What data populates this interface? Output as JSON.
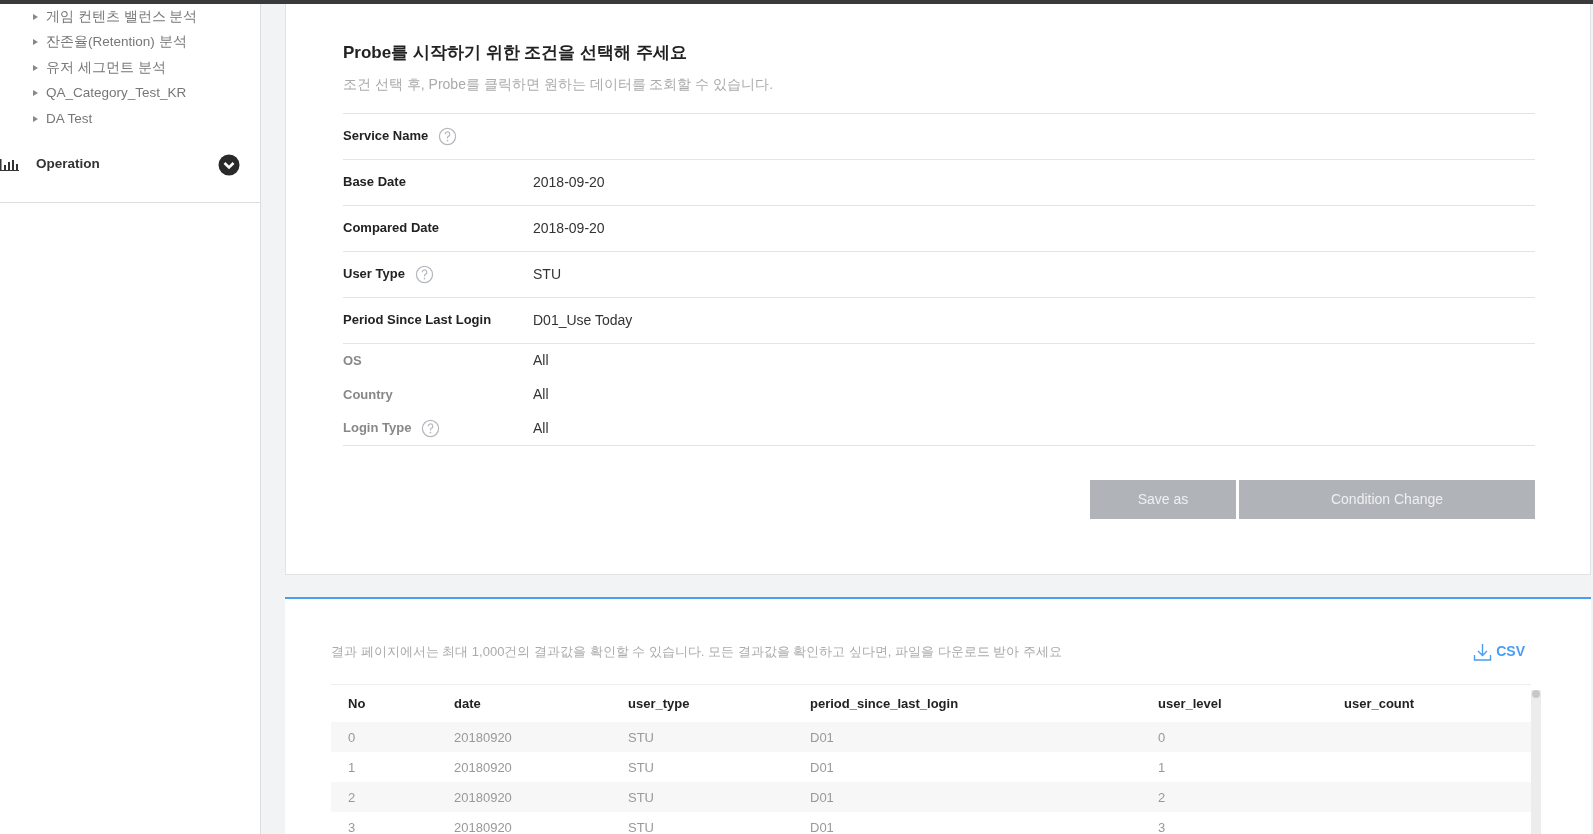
{
  "sidebar": {
    "items": [
      {
        "label": "게임 컨텐츠 밸런스 분석"
      },
      {
        "label": "잔존율(Retention) 분석"
      },
      {
        "label": "유저 세그먼트 분석"
      },
      {
        "label": "QA_Category_Test_KR"
      },
      {
        "label": "DA Test"
      }
    ],
    "section": {
      "label": "Operation",
      "expanded": true
    }
  },
  "conditions": {
    "title": "Probe를 시작하기 위한 조건을 선택해 주세요",
    "subtitle": "조건 선택 후, Probe를 클릭하면 원하는 데이터를 조회할 수 있습니다.",
    "rows": [
      {
        "kind": "main",
        "label": "Service Name",
        "help": true
      },
      {
        "kind": "main",
        "label": "Base Date",
        "help": false,
        "value": "2018-09-20"
      },
      {
        "kind": "main",
        "label": "Compared Date",
        "help": false,
        "value": "2018-09-20"
      },
      {
        "kind": "main",
        "label": "User Type",
        "help": true,
        "value": "STU"
      },
      {
        "kind": "main",
        "label": "Period Since Last Login",
        "help": false,
        "value": "D01_Use Today"
      },
      {
        "kind": "minor",
        "label": "OS",
        "help": false,
        "value": "All"
      },
      {
        "kind": "minor",
        "label": "Country",
        "help": false,
        "value": "All"
      },
      {
        "kind": "minor",
        "label": "Login Type",
        "help": true,
        "value": "All"
      }
    ],
    "buttons": [
      {
        "label": "Save as",
        "disabled": true
      },
      {
        "label": "Condition Change",
        "disabled": true
      }
    ]
  },
  "results": {
    "notice": "결과 페이지에서는 최대 1,000건의 결과값을 확인할 수 있습니다. 모든 결과값을 확인하고 싶다면, 파일을 다운로드 받아 주세요",
    "download": "CSV",
    "columns": [
      "No",
      "date",
      "user_type",
      "period_since_last_login",
      "user_level",
      "user_count"
    ],
    "rows": [
      [
        "0",
        "20180920",
        "STU",
        "D01",
        "0",
        ""
      ],
      [
        "1",
        "20180920",
        "STU",
        "D01",
        "1",
        ""
      ],
      [
        "2",
        "20180920",
        "STU",
        "D01",
        "2",
        ""
      ],
      [
        "3",
        "20180920",
        "STU",
        "D01",
        "3",
        ""
      ]
    ]
  }
}
